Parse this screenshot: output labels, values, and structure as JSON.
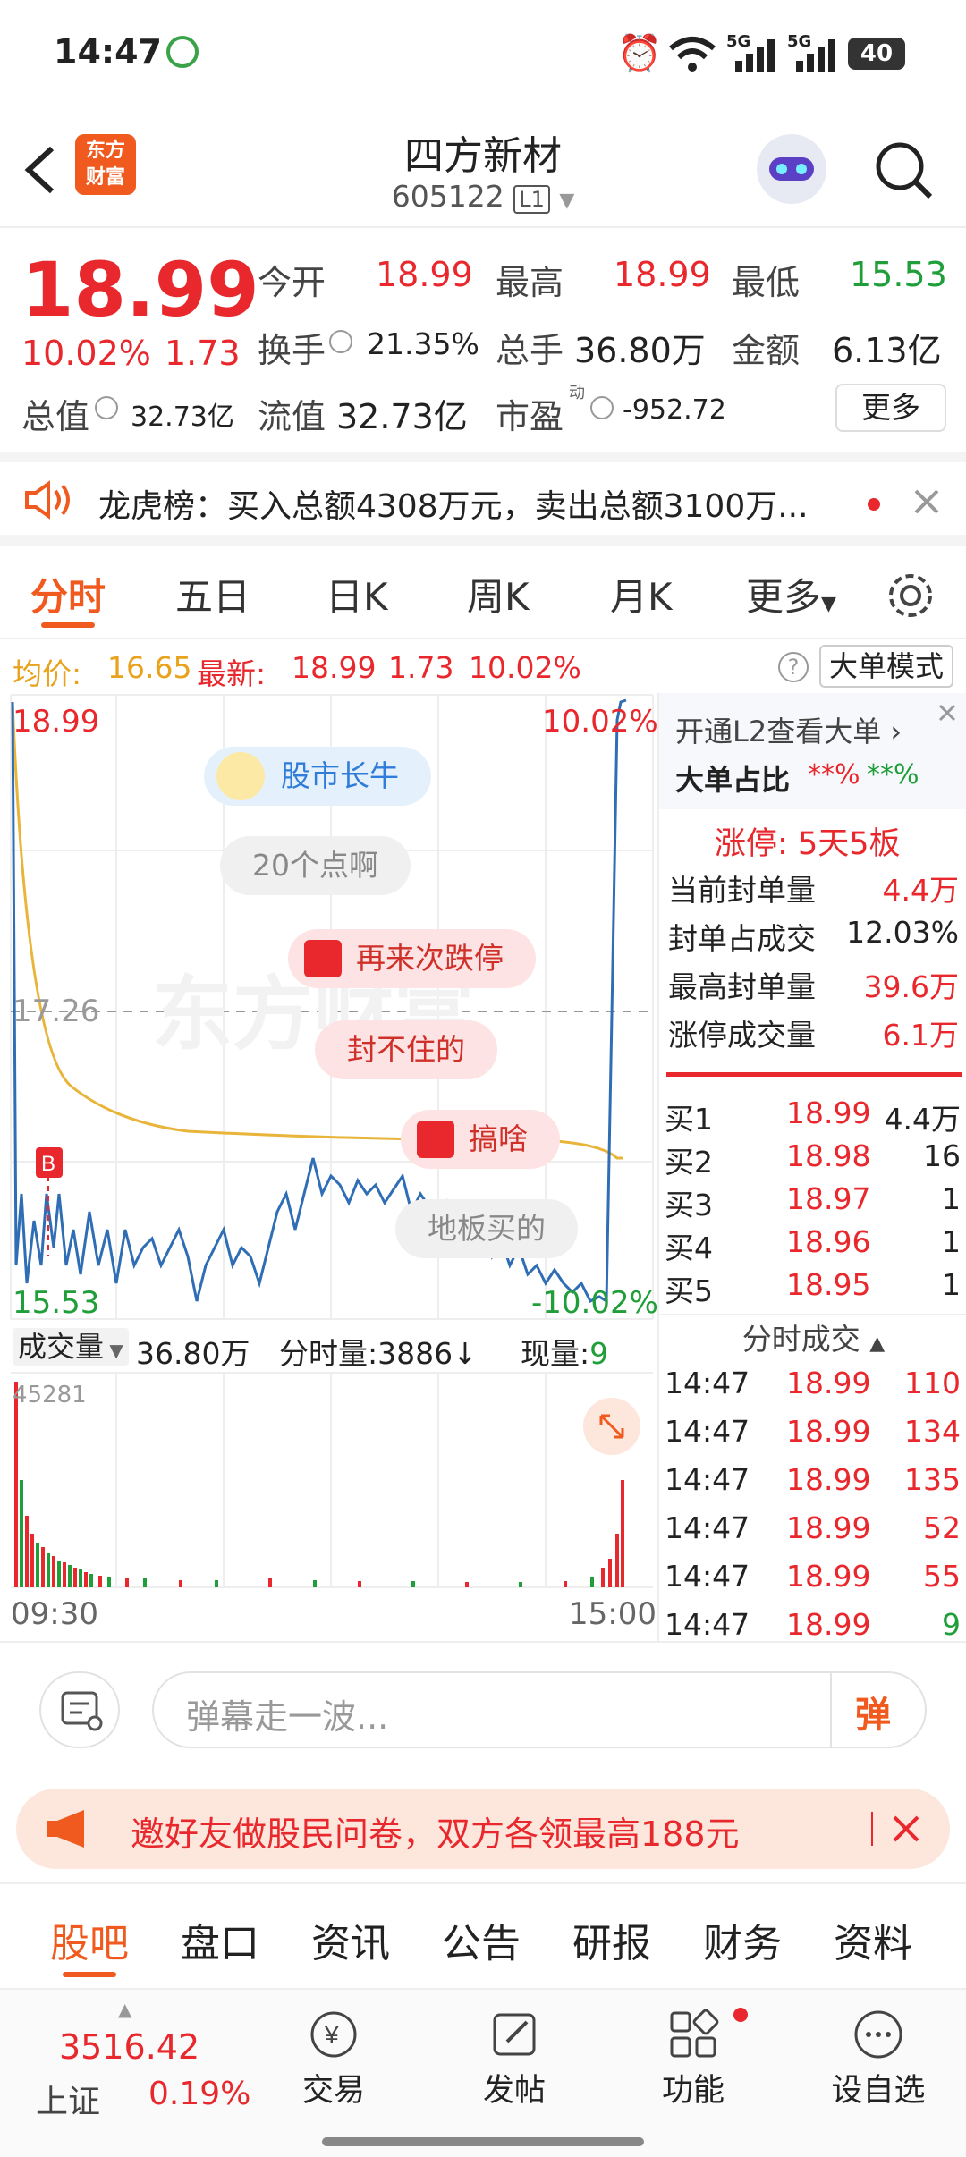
{
  "status": {
    "time": "14:47",
    "battery": "40",
    "net1": "5G",
    "net2": "5G"
  },
  "header": {
    "logo_line1": "东方",
    "logo_line2": "财富",
    "name": "四方新材",
    "code": "605122",
    "level": "L1"
  },
  "quote": {
    "price": "18.99",
    "pct": "10.02%",
    "chg": "1.73",
    "open_label": "今开",
    "open": "18.99",
    "high_label": "最高",
    "high": "18.99",
    "low_label": "最低",
    "low": "15.53",
    "turnover_label": "换手",
    "turnover": "21.35%",
    "vol_label": "总手",
    "vol": "36.80万",
    "amount_label": "金额",
    "amount": "6.13亿",
    "mktcap_label": "总值",
    "mktcap": "32.73亿",
    "float_label": "流值",
    "float": "32.73亿",
    "pe_label": "市盈",
    "pe_sup": "动",
    "pe": "-952.72",
    "more": "更多"
  },
  "notice": {
    "text": "龙虎榜：买入总额4308万元，卖出总额3100万..."
  },
  "tabs": [
    "分时",
    "五日",
    "日K",
    "周K",
    "月K",
    "更多"
  ],
  "legend": {
    "avg_label": "均价:",
    "avg": "16.65",
    "last_label": "最新:",
    "last": "18.99",
    "chg": "1.73",
    "pct": "10.02%",
    "mode": "大单模式"
  },
  "chart": {
    "top_price": "18.99",
    "top_pct": "10.02%",
    "mid_price": "17.26",
    "bot_price": "15.53",
    "bot_pct": "-10.02%",
    "b_marker": "B",
    "watermark": "东方财富"
  },
  "bubbles": [
    "股市长牛",
    "20个点啊",
    "再来次跌停",
    "封不住的",
    "搞啥",
    "地板买的"
  ],
  "volume": {
    "label": "成交量",
    "total": "36.80万",
    "tick_label": "分时量:3886↓",
    "cur_label": "现量:",
    "cur": "9",
    "max": "45281",
    "start": "09:30",
    "end": "15:00"
  },
  "panel": {
    "l2": "开通L2查看大单",
    "big_label": "大单占比",
    "big1": "**%",
    "big2": "**%",
    "limit_label": "涨停:",
    "limit": "5天5板",
    "stats": [
      {
        "k": "当前封单量",
        "v": "4.4万"
      },
      {
        "k": "封单占成交",
        "v": "12.03%"
      },
      {
        "k": "最高封单量",
        "v": "39.6万"
      },
      {
        "k": "涨停成交量",
        "v": "6.1万"
      }
    ],
    "bids": [
      {
        "k": "买1",
        "p": "18.99",
        "v": "4.4万"
      },
      {
        "k": "买2",
        "p": "18.98",
        "v": "16"
      },
      {
        "k": "买3",
        "p": "18.97",
        "v": "1"
      },
      {
        "k": "买4",
        "p": "18.96",
        "v": "1"
      },
      {
        "k": "买5",
        "p": "18.95",
        "v": "1"
      }
    ],
    "ticks_label": "分时成交",
    "ticks": [
      {
        "t": "14:47",
        "p": "18.99",
        "v": "110"
      },
      {
        "t": "14:47",
        "p": "18.99",
        "v": "134"
      },
      {
        "t": "14:47",
        "p": "18.99",
        "v": "135"
      },
      {
        "t": "14:47",
        "p": "18.99",
        "v": "52"
      },
      {
        "t": "14:47",
        "p": "18.99",
        "v": "55"
      },
      {
        "t": "14:47",
        "p": "18.99",
        "v": "9"
      }
    ]
  },
  "danmu": {
    "placeholder": "弹幕走一波...",
    "btn": "弹"
  },
  "invite": {
    "text": "邀好友做股民问卷，双方各领最高188元"
  },
  "bottom_tabs": [
    "股吧",
    "盘口",
    "资讯",
    "公告",
    "研报",
    "财务",
    "资料"
  ],
  "dock": {
    "index_value": "3516.42",
    "index_name": "上证",
    "index_pct": "0.19%",
    "trade": "交易",
    "post": "发帖",
    "func": "功能",
    "fav": "设自选"
  },
  "colors": {
    "up": "#e8282d",
    "down": "#1f9e3a",
    "price_line": "#2f6db5",
    "avg_line": "#e8b43a",
    "accent": "#f05a1e"
  }
}
